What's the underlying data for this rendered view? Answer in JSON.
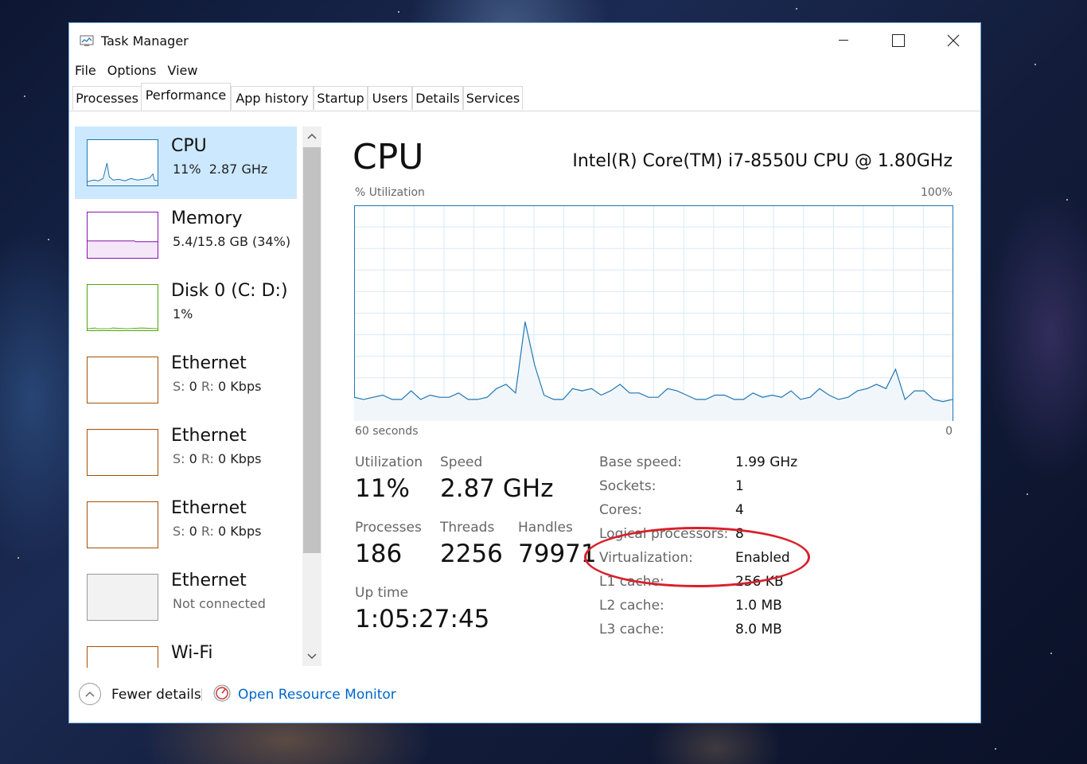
{
  "window": {
    "title": "Task Manager",
    "controls": [
      "minimize-icon",
      "maximize-icon",
      "close-icon"
    ]
  },
  "menu": [
    "File",
    "Options",
    "View"
  ],
  "tabs": [
    "Processes",
    "Performance",
    "App history",
    "Startup",
    "Users",
    "Details",
    "Services"
  ],
  "active_tab": "Performance",
  "sidebar": {
    "items": [
      {
        "name": "CPU",
        "sub1": "11%",
        "sub2": "2.87 GHz",
        "color": "#1f77b4"
      },
      {
        "name": "Memory",
        "sub": "5.4/15.8 GB (34%)",
        "color": "#8b12ae"
      },
      {
        "name": "Disk 0 (C: D:)",
        "sub": "1%",
        "color": "#4da60c"
      },
      {
        "name": "Ethernet",
        "s_label": "S:",
        "s_value": "0",
        "r_label": "R:",
        "r_value": "0 Kbps",
        "color": "#a74f01"
      },
      {
        "name": "Ethernet",
        "s_label": "S:",
        "s_value": "0",
        "r_label": "R:",
        "r_value": "0 Kbps",
        "color": "#a74f01"
      },
      {
        "name": "Ethernet",
        "s_label": "S:",
        "s_value": "0",
        "r_label": "R:",
        "r_value": "0 Kbps",
        "color": "#a74f01"
      },
      {
        "name": "Ethernet",
        "sub": "Not connected",
        "color": "#999999"
      },
      {
        "name": "Wi-Fi",
        "color": "#a74f01"
      }
    ]
  },
  "main": {
    "title": "CPU",
    "model": "Intel(R) Core(TM) i7-8550U CPU @ 1.80GHz",
    "graph_label_top_left": "% Utilization",
    "graph_label_top_right": "100%",
    "graph_label_bottom_left": "60 seconds",
    "graph_label_bottom_right": "0",
    "stats": {
      "utilization_label": "Utilization",
      "utilization": "11%",
      "speed_label": "Speed",
      "speed": "2.87 GHz",
      "processes_label": "Processes",
      "processes": "186",
      "threads_label": "Threads",
      "threads": "2256",
      "handles_label": "Handles",
      "handles": "79971",
      "uptime_label": "Up time",
      "uptime": "1:05:27:45"
    },
    "specs": [
      {
        "label": "Base speed:",
        "value": "1.99 GHz"
      },
      {
        "label": "Sockets:",
        "value": "1"
      },
      {
        "label": "Cores:",
        "value": "4"
      },
      {
        "label": "Logical processors:",
        "value": "8"
      },
      {
        "label": "Virtualization:",
        "value": "Enabled"
      },
      {
        "label": "L1 cache:",
        "value": "256 KB"
      },
      {
        "label": "L2 cache:",
        "value": "1.0 MB"
      },
      {
        "label": "L3 cache:",
        "value": "8.0 MB"
      }
    ],
    "cpu_history": [
      11,
      10,
      11,
      12,
      10,
      10,
      14,
      10,
      12,
      11,
      11,
      13,
      10,
      10,
      11,
      15,
      17,
      13,
      46,
      26,
      12,
      10,
      10,
      15,
      14,
      15,
      12,
      14,
      17,
      13,
      13,
      11,
      11,
      15,
      14,
      12,
      10,
      10,
      12,
      12,
      10,
      10,
      13,
      11,
      12,
      11,
      14,
      10,
      11,
      15,
      12,
      10,
      11,
      14,
      15,
      17,
      15,
      24,
      10,
      14,
      14,
      10,
      9,
      10
    ],
    "history_color": "#1f77b4"
  },
  "footer": {
    "fewer_details": "Fewer details",
    "open_resource_monitor": "Open Resource Monitor"
  }
}
